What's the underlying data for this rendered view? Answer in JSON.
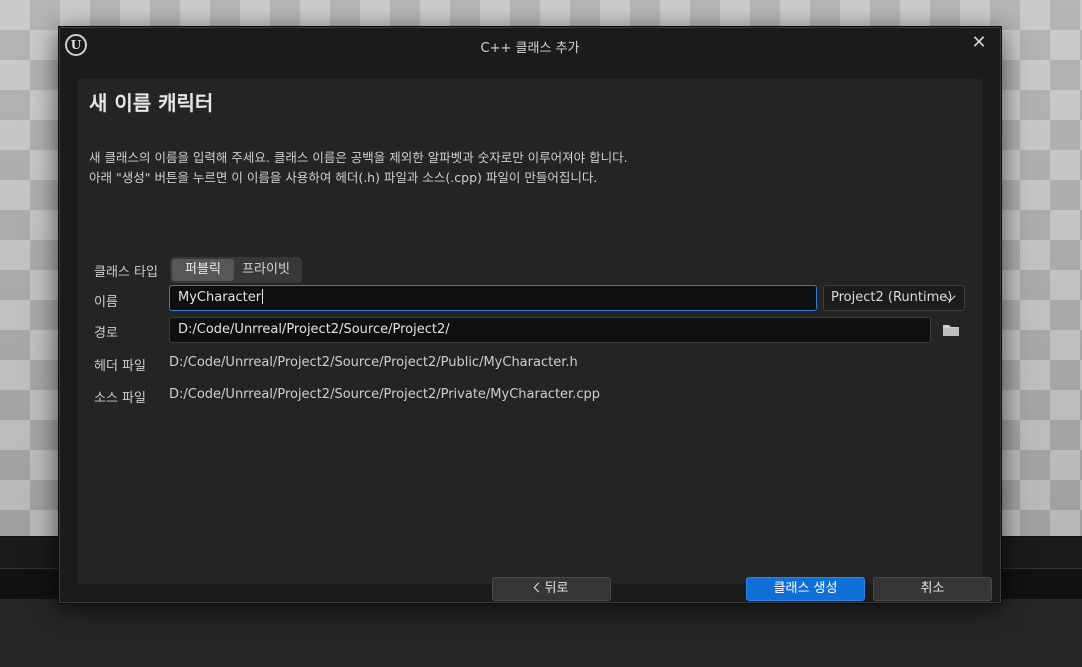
{
  "dialog": {
    "title": "C++ 클래스 추가",
    "close_label": "✕"
  },
  "content": {
    "heading": "새 이름 캐릭터",
    "description_line1": "새 클래스의 이름을 입력해 주세요. 클래스 이름은 공백을 제외한 알파벳과 숫자로만 이루어져야 합니다.",
    "description_line2": "아래 \"생성\" 버튼을 누르면 이 이름을 사용하여 헤더(.h) 파일과 소스(.cpp) 파일이 만들어집니다."
  },
  "form": {
    "class_type": {
      "label": "클래스 타입",
      "options": [
        "퍼블릭",
        "프라이빗"
      ],
      "selected": "퍼블릭"
    },
    "name": {
      "label": "이름",
      "value": "MyCharacter"
    },
    "module": {
      "selected": "Project2 (Runtime)"
    },
    "path": {
      "label": "경로",
      "value": "D:/Code/Unrreal/Project2/Source/Project2/"
    },
    "header_file": {
      "label": "헤더 파일",
      "value": "D:/Code/Unrreal/Project2/Source/Project2/Public/MyCharacter.h"
    },
    "source_file": {
      "label": "소스 파일",
      "value": "D:/Code/Unrreal/Project2/Source/Project2/Private/MyCharacter.cpp"
    }
  },
  "footer": {
    "back_label": "뒤로",
    "create_label": "클래스 생성",
    "cancel_label": "취소"
  },
  "icons": {
    "logo": "unreal-logo-icon",
    "close": "close-icon",
    "dropdown": "chevron-down-icon",
    "folder": "folder-icon",
    "back": "chevron-left-icon"
  },
  "colors": {
    "accent": "#0f6fd6",
    "focus_border": "#2d7bd6",
    "dialog_bg": "#1b1b1b",
    "panel_bg": "#242424"
  }
}
